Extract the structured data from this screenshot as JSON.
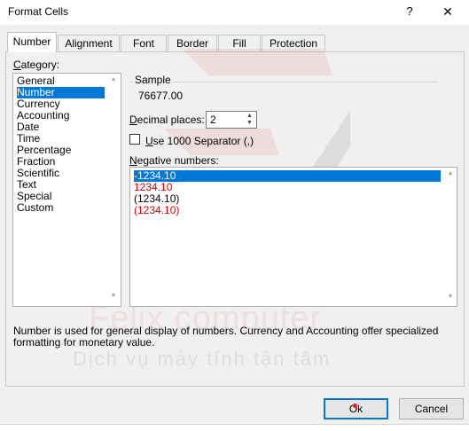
{
  "window": {
    "title": "Format Cells",
    "help_label": "?",
    "close_label": "✕"
  },
  "tabs": [
    {
      "label": "Number",
      "active": true
    },
    {
      "label": "Alignment"
    },
    {
      "label": "Font"
    },
    {
      "label": "Border"
    },
    {
      "label": "Fill"
    },
    {
      "label": "Protection"
    }
  ],
  "category": {
    "label_underlined": "C",
    "label_rest": "ategory:",
    "items": [
      "General",
      "Number",
      "Currency",
      "Accounting",
      "Date",
      "Time",
      "Percentage",
      "Fraction",
      "Scientific",
      "Text",
      "Special",
      "Custom"
    ],
    "selected": "Number"
  },
  "sample": {
    "legend": "Sample",
    "value": "76677.00"
  },
  "decimal": {
    "label_underlined": "D",
    "label_rest": "ecimal places:",
    "value": "2"
  },
  "separator": {
    "label_underlined": "U",
    "label_rest": "se 1000 Separator (,)",
    "checked": false
  },
  "negative": {
    "label_underlined": "N",
    "label_rest": "egative numbers:",
    "items": [
      {
        "text": "-1234.10",
        "color": "#ffffff",
        "selected": true
      },
      {
        "text": "1234.10",
        "color": "#e00000"
      },
      {
        "text": "(1234.10)",
        "color": "#000000"
      },
      {
        "text": "(1234.10)",
        "color": "#e00000"
      }
    ]
  },
  "description": "Number is used for general display of numbers.  Currency and Accounting offer specialized formatting for monetary value.",
  "watermark": {
    "title": "Felix computer",
    "subtitle": "Dịch vụ máy tính tận tâm"
  },
  "buttons": {
    "ok": "Ok",
    "cancel": "Cancel"
  },
  "colors": {
    "selection": "#0078d7",
    "negative_red": "#e00000",
    "watermark_red": "#e34a4a"
  },
  "icons": {
    "scroll_up": "chevron-up-icon",
    "scroll_down": "chevron-down-icon",
    "close": "close-icon"
  }
}
